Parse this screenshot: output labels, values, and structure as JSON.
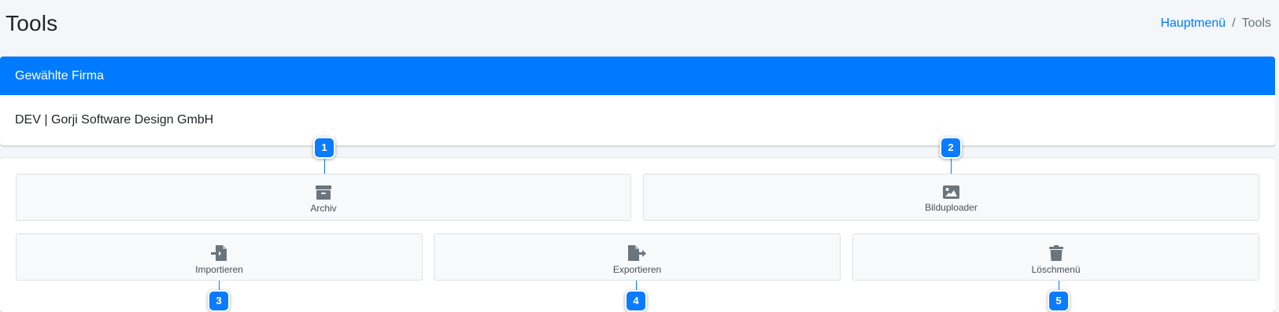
{
  "header": {
    "title": "Tools",
    "breadcrumb": {
      "home": "Hauptmenü",
      "separator": "/",
      "current": "Tools"
    }
  },
  "company": {
    "header": "Gewählte Firma",
    "name": "DEV | Gorji Software Design GmbH"
  },
  "tools": [
    {
      "label": "Archiv",
      "icon": "archive-icon",
      "badge": "1"
    },
    {
      "label": "Bilduploader",
      "icon": "image-icon",
      "badge": "2"
    },
    {
      "label": "Importieren",
      "icon": "file-import-icon",
      "badge": "3"
    },
    {
      "label": "Exportieren",
      "icon": "file-export-icon",
      "badge": "4"
    },
    {
      "label": "Löschmenü",
      "icon": "trash-icon",
      "badge": "5"
    }
  ],
  "colors": {
    "primary": "#007bff",
    "background": "#f4f6f9",
    "icon": "#6c757d"
  }
}
